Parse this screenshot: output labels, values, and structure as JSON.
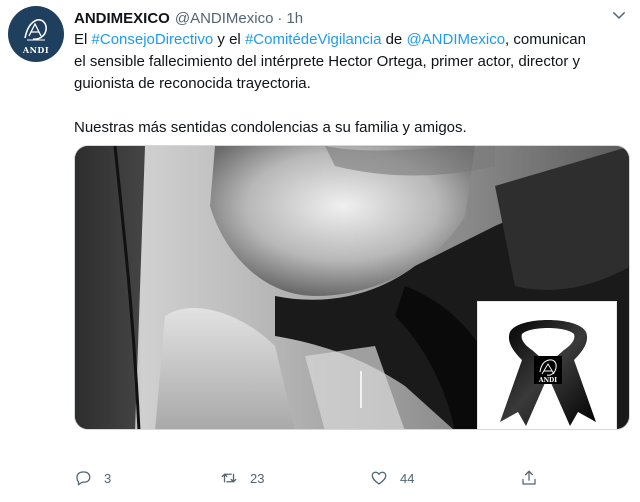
{
  "author": {
    "name": "ANDIMEXICO",
    "handle": "@ANDIMexico",
    "separator": "·",
    "time": "1h",
    "avatar_text": "ANDI"
  },
  "tweet": {
    "line1": {
      "t1": "El ",
      "tag1": "#ConsejoDirectivo",
      "t2": " y el ",
      "tag2": "#ComitédeVigilancia",
      "t3": " de ",
      "mention": "@ANDIMexico",
      "t4": ", comunican"
    },
    "line2": "el sensible fallecimiento del intérprete Hector Ortega, primer actor, director y",
    "line3": "guionista de reconocida trayectoria.",
    "line4": "Nuestras más sentidas condolencias a su familia y amigos."
  },
  "media": {
    "badge_text": "ANDI"
  },
  "actions": {
    "reply_count": "3",
    "retweet_count": "23",
    "like_count": "44"
  },
  "colors": {
    "link": "#1d9bf0",
    "secondary_text": "#536471",
    "avatar_bg": "#1f3f5f"
  },
  "icons": {
    "caret": "chevron-down-icon",
    "reply": "reply-icon",
    "retweet": "retweet-icon",
    "like": "heart-icon",
    "share": "share-icon"
  }
}
